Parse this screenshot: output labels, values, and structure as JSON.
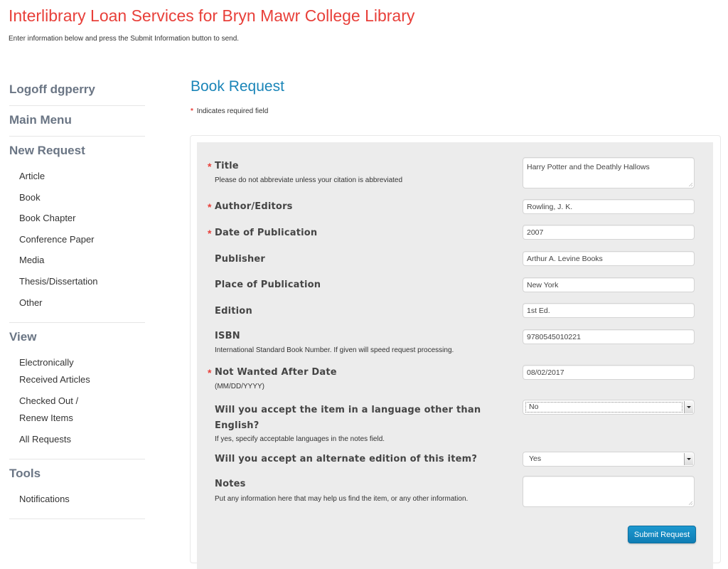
{
  "header": {
    "title": "Interlibrary Loan Services for Bryn Mawr College Library",
    "subtitle": "Enter information below and press the Submit Information button to send."
  },
  "sidebar": {
    "logoff": "Logoff dgperry",
    "main_menu": "Main Menu",
    "new_request": {
      "heading": "New Request",
      "items": [
        "Article",
        "Book",
        "Book Chapter",
        "Conference Paper",
        "Media",
        "Thesis/Dissertation",
        "Other"
      ]
    },
    "view": {
      "heading": "View",
      "items": [
        {
          "line1": "Electronically",
          "line2": "Received Articles"
        },
        {
          "line1": "Checked Out /",
          "line2": "Renew Items"
        },
        {
          "line1": "All Requests"
        }
      ]
    },
    "tools": {
      "heading": "Tools",
      "items": [
        "Notifications"
      ]
    }
  },
  "main": {
    "page_title": "Book Request",
    "required_star": "*",
    "required_note": "Indicates required field",
    "fields": {
      "title": {
        "label": "Title",
        "required": true,
        "help": "Please do not abbreviate unless your citation is abbreviated",
        "value": "Harry Potter and the Deathly Hallows"
      },
      "author": {
        "label": "Author/Editors",
        "required": true,
        "value": "Rowling, J. K."
      },
      "date": {
        "label": "Date of Publication",
        "required": true,
        "value": "2007"
      },
      "publisher": {
        "label": "Publisher",
        "value": "Arthur A. Levine Books"
      },
      "place": {
        "label": "Place of Publication",
        "value": "New York"
      },
      "edition": {
        "label": "Edition",
        "value": "1st Ed."
      },
      "isbn": {
        "label": "ISBN",
        "help": "International Standard Book Number. If given will speed request processing.",
        "value": "9780545010221"
      },
      "not_wanted": {
        "label": "Not Wanted After Date",
        "required": true,
        "help": "(MM/DD/YYYY)",
        "value": "08/02/2017"
      },
      "language": {
        "label_line1": "Will you accept the item in a language other than",
        "label_line2": "English?",
        "help": "If yes, specify acceptable languages in the notes field.",
        "value": "No"
      },
      "alternate": {
        "label": "Will you accept an alternate edition of this item?",
        "value": "Yes"
      },
      "notes": {
        "label": "Notes",
        "help": "Put any information here that may help us find the item, or any other information.",
        "value": ""
      }
    },
    "submit_label": "Submit Request"
  }
}
